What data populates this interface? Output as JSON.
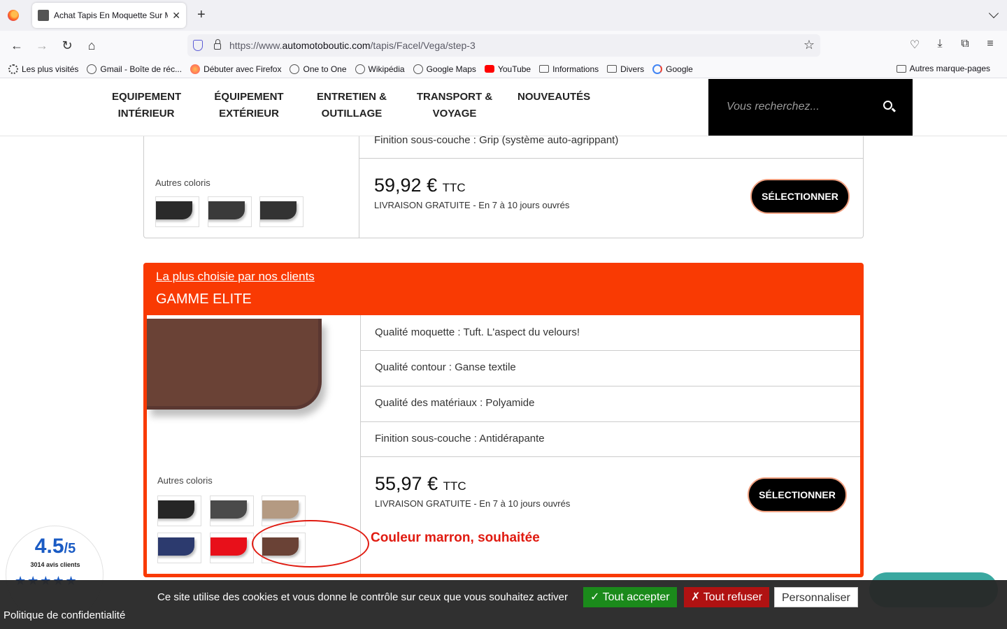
{
  "browser": {
    "tab_title": "Achat Tapis En Moquette Sur M…",
    "url_prefix": "https://www.",
    "url_domain": "automotoboutic.com",
    "url_path": "/tapis/Facel/Vega/step-3",
    "bookmarks": [
      {
        "label": "Les plus visités",
        "icon": "gear-icon"
      },
      {
        "label": "Gmail - Boîte de réc...",
        "icon": "globe-icon"
      },
      {
        "label": "Débuter avec Firefox",
        "icon": "firefox-icon"
      },
      {
        "label": "One to One",
        "icon": "globe-icon"
      },
      {
        "label": "Wikipédia",
        "icon": "globe-icon"
      },
      {
        "label": "Google Maps",
        "icon": "globe-icon"
      },
      {
        "label": "YouTube",
        "icon": "youtube-icon"
      },
      {
        "label": "Informations",
        "icon": "folder-icon"
      },
      {
        "label": "Divers",
        "icon": "folder-icon"
      },
      {
        "label": "Google",
        "icon": "google-icon"
      }
    ],
    "other_bookmarks": "Autres marque-pages"
  },
  "header": {
    "menu": [
      {
        "line1": "EQUIPEMENT",
        "line2": "INTÉRIEUR"
      },
      {
        "line1": "ÉQUIPEMENT",
        "line2": "EXTÉRIEUR"
      },
      {
        "line1": "ENTRETIEN &",
        "line2": "OUTILLAGE"
      },
      {
        "line1": "TRANSPORT &",
        "line2": "VOYAGE"
      },
      {
        "line1": "NOUVEAUTÉS",
        "line2": ""
      }
    ],
    "search_placeholder": "Vous recherchez..."
  },
  "product1": {
    "feature_last": "Finition sous-couche : Grip (système auto-agrippant)",
    "autres_coloris": "Autres coloris",
    "swatches": [
      "#2a2a2a",
      "#3a3a3a",
      "#333333"
    ],
    "price": "59,92 €",
    "price_suffix": "TTC",
    "delivery": "LIVRAISON GRATUITE - En 7 à 10 jours ouvrés",
    "button": "SÉLECTIONNER"
  },
  "product2": {
    "badge_link": "La plus choisie par nos clients",
    "name": "GAMME ELITE",
    "features": [
      "Qualité moquette : Tuft. L'aspect du velours!",
      "Qualité contour : Ganse textile",
      "Qualité des matériaux : Polyamide",
      "Finition sous-couche : Antidérapante"
    ],
    "autres_coloris": "Autres coloris",
    "swatches": [
      "#262626",
      "#4a4a4a",
      "#b49a82",
      "#2c3a6e",
      "#e8101a",
      "#6a4236"
    ],
    "price": "55,97 €",
    "price_suffix": "TTC",
    "delivery": "LIVRAISON GRATUITE - En 7 à 10 jours ouvrés",
    "button": "SÉLECTIONNER"
  },
  "annotation": "Couleur marron, souhaitée",
  "rating": {
    "score": "4.5",
    "max": "/5",
    "count": "3014 avis clients"
  },
  "cookie": {
    "message": "Ce site utilise des cookies et vous donne le contrôle sur ceux que vous souhaitez activer",
    "accept": "✓ Tout accepter",
    "refuse": "✗ Tout refuser",
    "customize": "Personnaliser",
    "policy": "Politique de confidentialité"
  },
  "colors": {
    "accent": "#f93a03",
    "annotation": "#e01a10",
    "rating": "#1a5bc4"
  }
}
